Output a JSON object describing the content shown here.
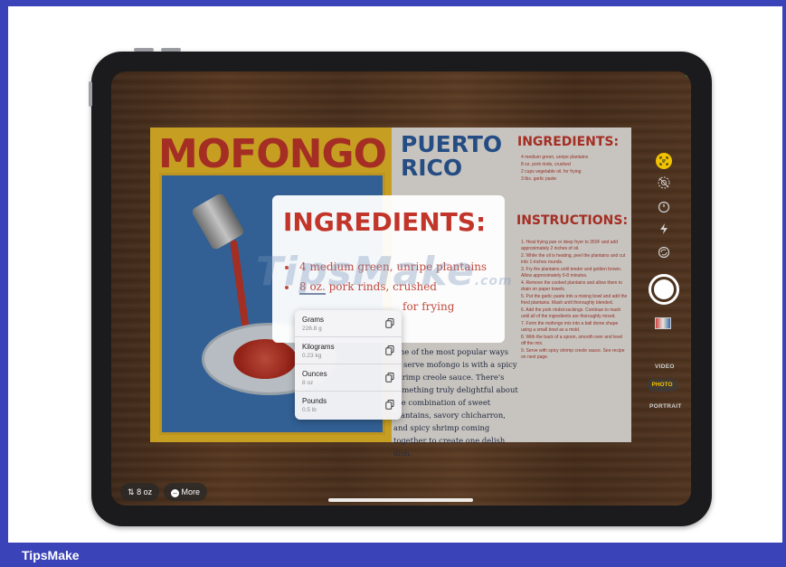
{
  "poster": {
    "title": "MOFONGO",
    "region_title": "PUERTO RICO",
    "ingredients_heading": "INGREDIENTS:",
    "instructions_heading": "INSTRUCTIONS:",
    "ingredients_small": [
      "4 medium green, unripe plantains",
      "8 oz. pork rinds, crushed",
      "2 cups vegetable oil, for frying",
      "3 tbs. garlic paste"
    ],
    "instructions_small": [
      "1. Heat frying pan or deep fryer to 350F and add approximately 2 inches of oil.",
      "2. While the oil is heating, peel the plantains and cut into 1-inches rounds.",
      "3. Fry the plantains until tender and golden brown. Allow approximately 6-8 minutes.",
      "4. Remove the cooked plantains and allow them to drain on paper towels.",
      "5. Put the garlic paste into a mixing bowl and add the fried plantains. Mash until thoroughly blended.",
      "6. Add the pork rinds/crackings. Continue to mash until all of the ingredients are thoroughly mixed.",
      "7. Form the mofongo mix into a ball dome shape using a small bowl as a mold.",
      "8. With the back of a spoon, smooth over and level off the mix.",
      "9. Serve with spicy shrimp creole sauce. See recipe on next page."
    ],
    "body_text": "One of the most popular ways to serve mofongo is with a spicy shrimp creole sauce. There's something truly delightful about the combination of sweet plantains, savory chicharron, and spicy shrimp coming together to create one delish dish."
  },
  "popup": {
    "heading": "INGREDIENTS:",
    "line1": "4 medium green, unripe plantains",
    "line2_highlight": "8 oz.",
    "line2_rest": " pork rinds, crushed",
    "line3": "for frying"
  },
  "conversion_menu": [
    {
      "label": "Grams",
      "value": "226.8 g"
    },
    {
      "label": "Kilograms",
      "value": "0.23 kg"
    },
    {
      "label": "Ounces",
      "value": "8 oz"
    },
    {
      "label": "Pounds",
      "value": "0.5 lb"
    }
  ],
  "camera": {
    "modes": [
      "VIDEO",
      "PHOTO",
      "PORTRAIT"
    ],
    "active_mode": "PHOTO",
    "accent_color": "#f1c200"
  },
  "bottom": {
    "unit_pill": "8 oz",
    "more_pill": "More"
  },
  "watermark": {
    "main": "TipsMake",
    "suffix": ".com"
  },
  "footer": {
    "brand": "TipsMake"
  }
}
